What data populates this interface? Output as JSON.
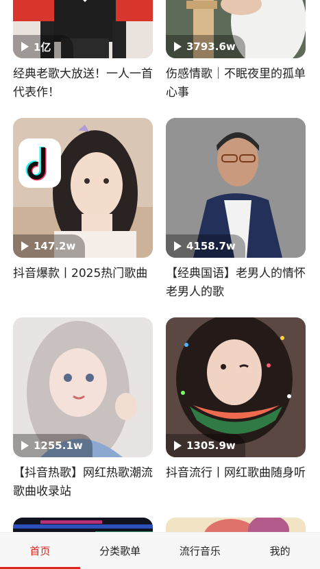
{
  "playlists": [
    {
      "play_count": "1亿",
      "title": "经典老歌大放送！一人一首代表作！"
    },
    {
      "play_count": "3793.6w",
      "title": "伤感情歌｜不眠夜里的孤单心事"
    },
    {
      "play_count": "147.2w",
      "title": "抖音爆款丨2025热门歌曲"
    },
    {
      "play_count": "4158.7w",
      "title": "【经典国语】老男人的情怀老男人的歌"
    },
    {
      "play_count": "1255.1w",
      "title": "【抖音热歌】网红热歌潮流歌曲收录站"
    },
    {
      "play_count": "1305.9w",
      "title": "抖音流行丨网红歌曲随身听"
    }
  ],
  "tabbar": {
    "tabs": [
      {
        "label": "首页",
        "active": true
      },
      {
        "label": "分类歌单",
        "active": false
      },
      {
        "label": "流行音乐",
        "active": false
      },
      {
        "label": "我的",
        "active": false
      }
    ],
    "accent_color": "#d9251d"
  },
  "icons": {
    "play": "play-icon"
  }
}
